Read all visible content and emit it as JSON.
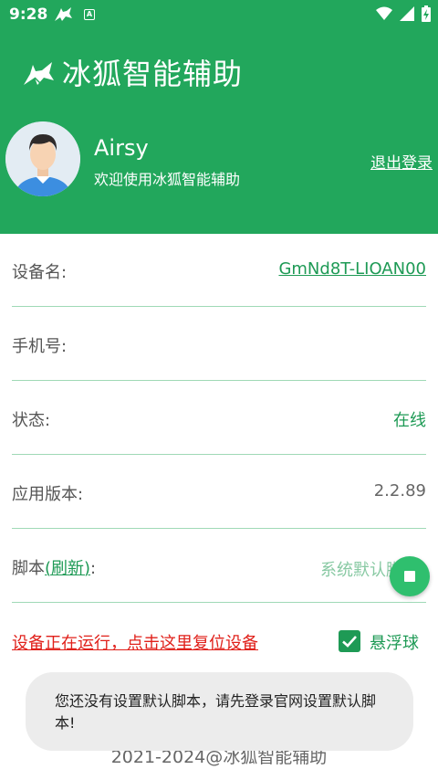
{
  "status_bar": {
    "time": "9:28",
    "icons": [
      "fox-app-icon",
      "a-badge-icon",
      "wifi-icon",
      "signal-icon",
      "battery-charging-icon"
    ],
    "a_badge": "A"
  },
  "app": {
    "title": "冰狐智能辅助",
    "brand_color": "#22a75c"
  },
  "user": {
    "name": "Airsy",
    "welcome": "欢迎使用冰狐智能辅助",
    "logout": "退出登录"
  },
  "info_rows": {
    "device_name": {
      "label": "设备名:",
      "value": "GmNd8T-LIOAN00"
    },
    "phone": {
      "label": "手机号:",
      "value": ""
    },
    "status": {
      "label": "状态:",
      "value": "在线"
    },
    "app_version": {
      "label": "应用版本:",
      "value": "2.2.89"
    },
    "script": {
      "label_prefix": "脚本",
      "refresh": "(刷新)",
      "label_suffix": ":",
      "value": "系统默认脚"
    }
  },
  "reset_link": "设备正在运行，点击这里复位设备",
  "float_ball": {
    "label": "悬浮球",
    "checked": true
  },
  "copyright": "2021-2024@冰狐智能辅助",
  "toast": "您还没有设置默认脚本，请先登录官网设置默认脚本!"
}
